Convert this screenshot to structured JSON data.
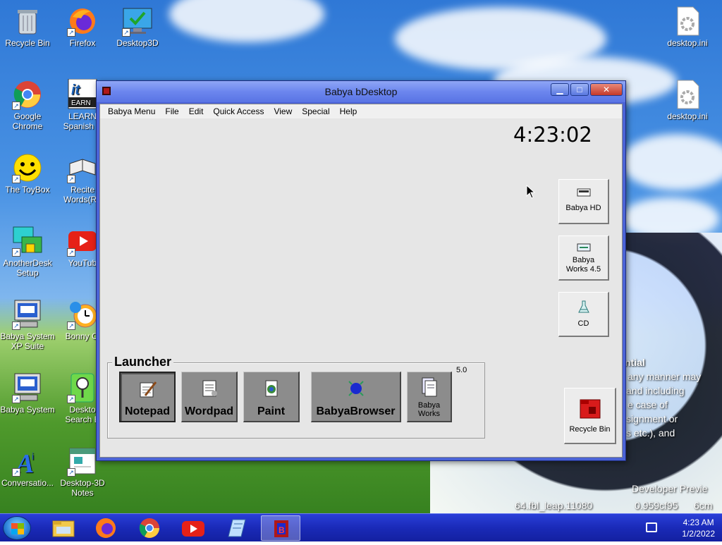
{
  "desktop": {
    "icons": [
      {
        "label": "Recycle Bin",
        "icon": "recycle-bin-icon"
      },
      {
        "label": "Firefox",
        "icon": "firefox-icon"
      },
      {
        "label": "Desktop3D",
        "icon": "desktop3d-icon"
      },
      {
        "label": "Google Chrome",
        "icon": "chrome-icon"
      },
      {
        "label": "LEARN Spanish V",
        "icon": "learn-spanish-icon"
      },
      {
        "label": "The ToyBox",
        "icon": "smiley-icon"
      },
      {
        "label": "Recite Words(Ru",
        "icon": "book-icon"
      },
      {
        "label": "AnotherDesk Setup",
        "icon": "anotherdesk-icon"
      },
      {
        "label": "YouTub",
        "icon": "youtube-icon"
      },
      {
        "label": "Babya System XP Suite",
        "icon": "computer-icon"
      },
      {
        "label": "Bonny Cl",
        "icon": "bonny-clock-icon"
      },
      {
        "label": "Babya System",
        "icon": "computer-icon"
      },
      {
        "label": "Deskto Search B",
        "icon": "search-icon"
      },
      {
        "label": "Conversatio...",
        "icon": "conversation-icon"
      },
      {
        "label": "Desktop-3D Notes",
        "icon": "notes-icon"
      },
      {
        "label": "desktop.ini",
        "icon": "settings-file-icon"
      },
      {
        "label": "desktop.ini",
        "icon": "settings-file-icon"
      }
    ],
    "wallpaper_text": [
      "ntial",
      "any manner may",
      "and including",
      "e case of",
      "signment or",
      "s etc.), and",
      "Developer Previe",
      "64.fbl_leap.11080",
      "0.959cf95",
      "6cm"
    ]
  },
  "window": {
    "title": "Babya bDesktop",
    "menu": [
      "Babya Menu",
      "File",
      "Edit",
      "Quick Access",
      "View",
      "Special",
      "Help"
    ],
    "clock": "4:23:02",
    "side_buttons": [
      {
        "label": "Babya HD",
        "icon": "hard-drive-icon"
      },
      {
        "label": "Babya Works 4.5",
        "icon": "drive-icon"
      },
      {
        "label": "CD",
        "icon": "cd-icon"
      }
    ],
    "recycle_bin": {
      "label": "Recycle Bin",
      "icon": "recycle-bin-icon"
    },
    "launcher": {
      "title": "Launcher",
      "version": "5.0",
      "buttons": [
        {
          "label": "Notepad",
          "icon": "notepad-icon"
        },
        {
          "label": "Wordpad",
          "icon": "wordpad-icon"
        },
        {
          "label": "Paint",
          "icon": "paint-icon"
        },
        {
          "label": "BabyaBrowser",
          "icon": "globe-icon"
        },
        {
          "label": "Babya Works",
          "icon": "babya-works-icon"
        }
      ]
    }
  },
  "taskbar": {
    "items": [
      "file-explorer-icon",
      "firefox-icon",
      "chrome-icon",
      "youtube-icon",
      "notepad-icon",
      "babya-bdesktop-icon"
    ],
    "time": "4:23 AM",
    "date": "1/2/2022"
  }
}
